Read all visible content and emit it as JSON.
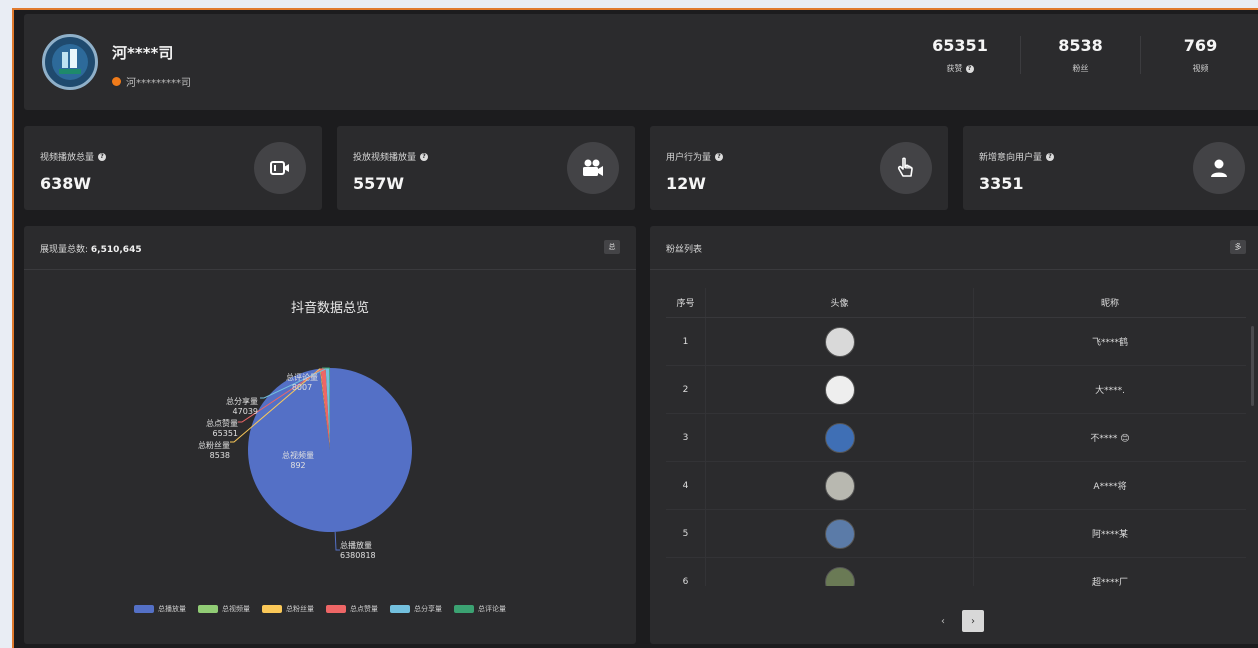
{
  "header": {
    "company_name": "河****司",
    "company_sub": "河*********司",
    "stats": [
      {
        "value": "65351",
        "label": "获赞",
        "has_help": true
      },
      {
        "value": "8538",
        "label": "粉丝",
        "has_help": false
      },
      {
        "value": "769",
        "label": "视频",
        "has_help": false
      }
    ]
  },
  "cards": [
    {
      "title": "视频播放总量",
      "value": "638W",
      "icon": "video-camera-icon"
    },
    {
      "title": "投放视频播放量",
      "value": "557W",
      "icon": "movie-camera-icon"
    },
    {
      "title": "用户行为量",
      "value": "12W",
      "icon": "tap-hand-icon"
    },
    {
      "title": "新增意向用户量",
      "value": "3351",
      "icon": "user-icon"
    }
  ],
  "pie_panel": {
    "title_prefix": "展现量总数:",
    "title_value": "6,510,645",
    "button": "总"
  },
  "chart_data": {
    "type": "pie",
    "title": "抖音数据总览",
    "labels": [
      "总播放量",
      "总视频量",
      "总粉丝量",
      "总点赞量",
      "总分享量",
      "总评论量"
    ],
    "values": [
      6380818,
      892,
      8538,
      65351,
      47039,
      8007
    ],
    "colors": [
      "#5470c6",
      "#91cc75",
      "#fac858",
      "#ee6666",
      "#73c0de",
      "#3ba272"
    ],
    "legend_position": "bottom"
  },
  "fans_panel": {
    "title": "粉丝列表",
    "button": "多",
    "columns": [
      "序号",
      "头像",
      "昵称"
    ],
    "rows": [
      {
        "idx": "1",
        "nick": "飞****鹤",
        "avatar_color": "#d9d9d9"
      },
      {
        "idx": "2",
        "nick": "大****.",
        "avatar_color": "#eeeeee"
      },
      {
        "idx": "3",
        "nick": "不**** 😊",
        "avatar_color": "#3f6fb5"
      },
      {
        "idx": "4",
        "nick": "A****将",
        "avatar_color": "#b8b8b0"
      },
      {
        "idx": "5",
        "nick": "阿****某",
        "avatar_color": "#5b7ba8"
      },
      {
        "idx": "6",
        "nick": "超****厂",
        "avatar_color": "#6a7a55"
      }
    ],
    "pager": {
      "prev": "‹",
      "next": "›"
    }
  }
}
